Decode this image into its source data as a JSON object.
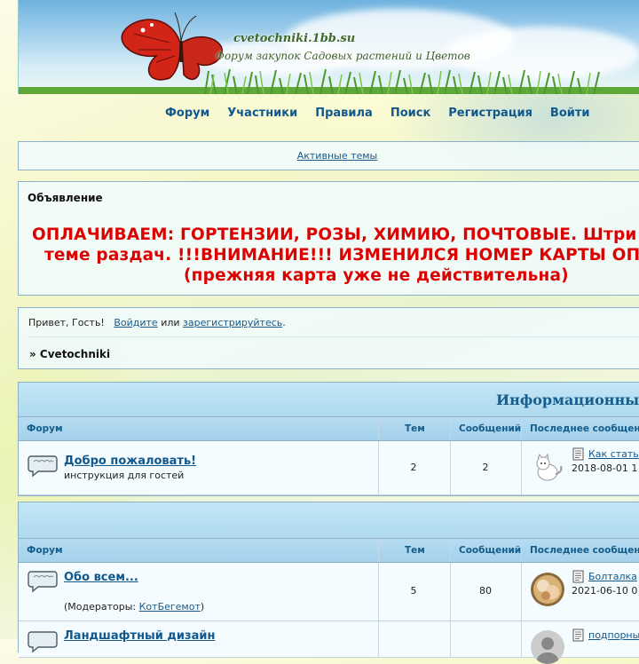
{
  "header": {
    "site_title": "cvetochniki.1bb.su",
    "site_subtitle": "Форум закупок Садовых растений и Цветов"
  },
  "nav": [
    "Форум",
    "Участники",
    "Правила",
    "Поиск",
    "Регистрация",
    "Войти"
  ],
  "active_topics": "Активные темы",
  "announcement": {
    "title": "Объявление",
    "line1": "ОПЛАЧИВАЕМ: ГОРТЕНЗИИ, РОЗЫ, ХИМИЮ, ПОЧТОВЫЕ. Штри",
    "line2": "теме раздач. !!!ВНИМАНИЕ!!! ИЗМЕНИЛСЯ НОМЕР КАРТЫ ОП",
    "line3": "(прежняя карта уже не действительна)"
  },
  "greeting": {
    "prefix": "Привет, Гость!",
    "login": "Войдите",
    "or": "или",
    "register": "зарегистрируйтесь",
    "suffix": "."
  },
  "breadcrumb": "» Cvetochniki",
  "categories": [
    {
      "title": "Информационны",
      "columns": [
        "Форум",
        "Тем",
        "Сообщений",
        "Последнее сообщени"
      ],
      "forums": [
        {
          "name": "Добро пожаловать!",
          "desc": "инструкция для гостей",
          "topics": "2",
          "posts": "2",
          "last_link": "Как стать",
          "last_date": "2018-08-01 1"
        }
      ]
    },
    {
      "title": "",
      "columns": [
        "Форум",
        "Тем",
        "Сообщений",
        "Последнее сообщени"
      ],
      "forums": [
        {
          "name": "Обо всем...",
          "moderators_prefix": "(Модераторы: ",
          "moderator": "КотБегемот",
          "moderators_suffix": ")",
          "topics": "5",
          "posts": "80",
          "last_link": "Болталка",
          "last_date": "2021-06-10 0"
        },
        {
          "name": "Ландшафтный дизайн",
          "last_link": "подпорны"
        }
      ]
    }
  ],
  "colors": {
    "accent": "#11588d",
    "announcement": "#dd0000",
    "header_bar": "#aed9ef"
  }
}
